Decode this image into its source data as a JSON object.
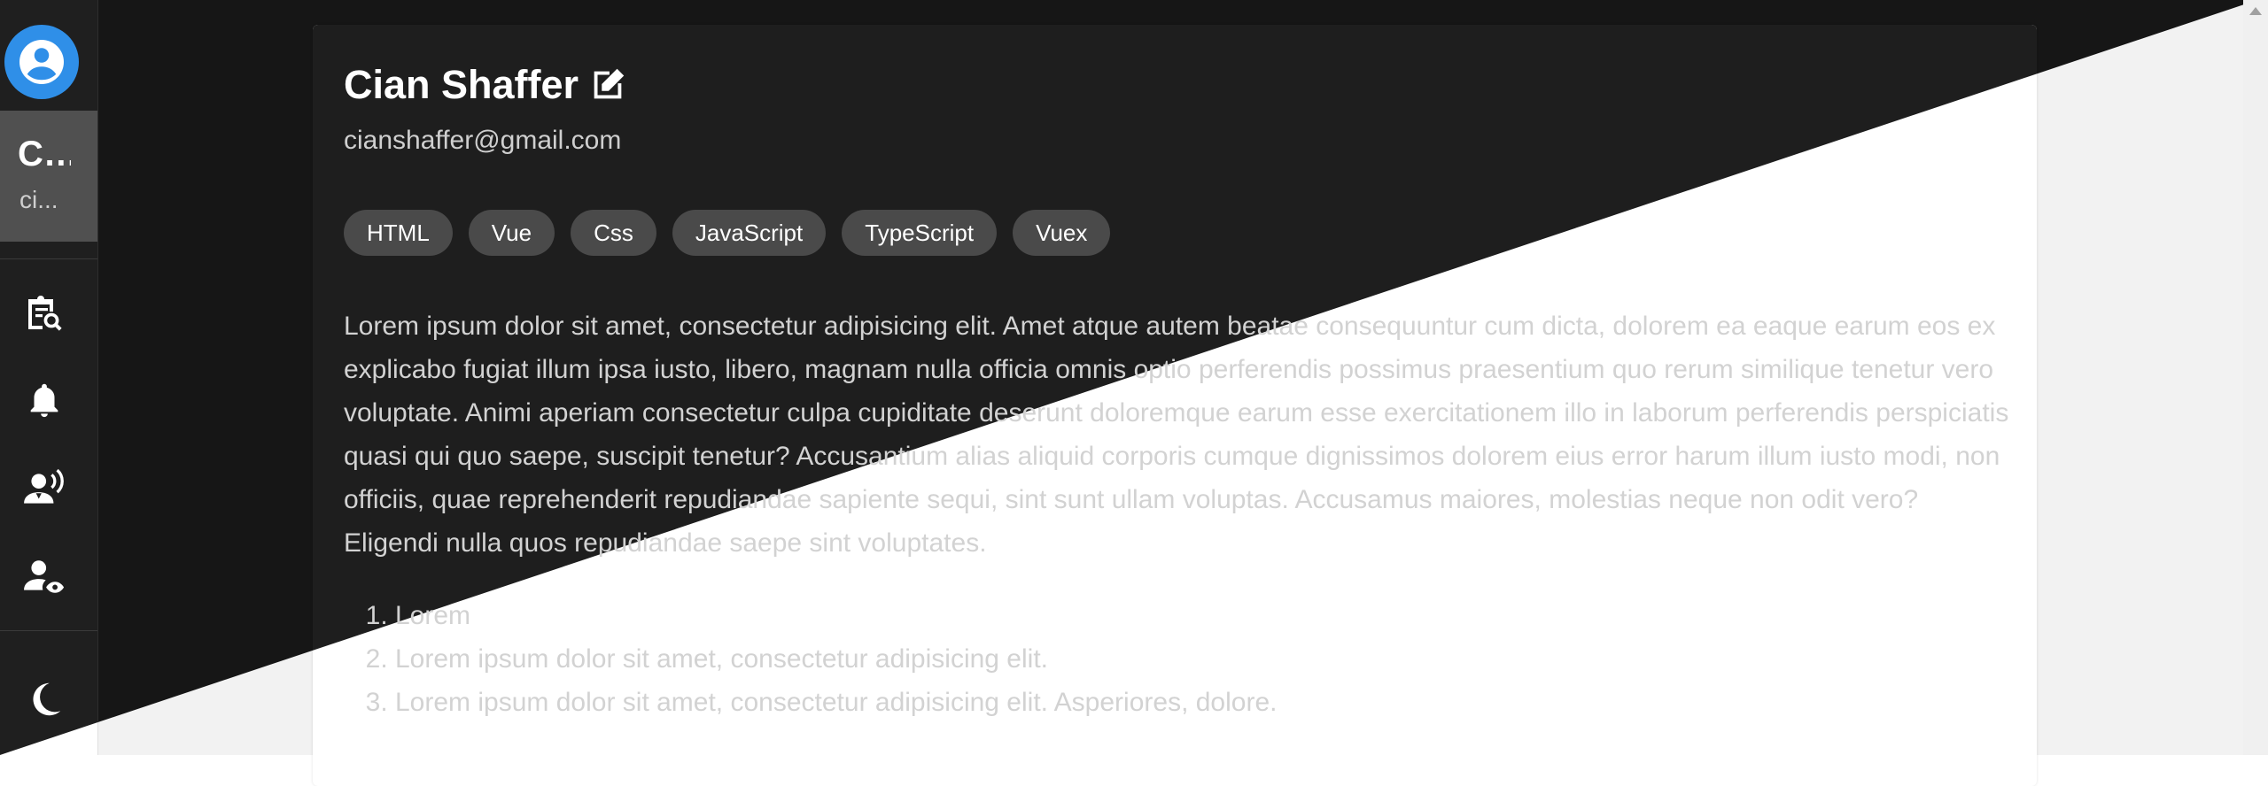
{
  "rail": {
    "user_name": "C...",
    "user_email": "ci...",
    "icons": [
      "account-circle-icon",
      "clipboard-search-icon",
      "bell-icon",
      "account-voice-icon",
      "account-eye-icon",
      "moon-icon"
    ]
  },
  "profile": {
    "name": "Cian Shaffer",
    "email": "cianshaffer@gmail.com",
    "tags": [
      "HTML",
      "Vue",
      "Css",
      "JavaScript",
      "TypeScript",
      "Vuex"
    ],
    "bio": "Lorem ipsum dolor sit amet, consectetur adipisicing elit. Amet atque autem beatae consequuntur cum dicta, dolorem ea eaque earum eos ex explicabo fugiat illum ipsa iusto, libero, magnam nulla officia omnis optio perferendis possimus praesentium quo rerum similique tenetur vero voluptate. Animi aperiam consectetur culpa cupiditate deserunt doloremque earum esse exercitationem illo in laborum perferendis perspiciatis quasi qui quo saepe, suscipit tenetur? Accusantium alias aliquid corporis cumque dignissimos dolorem eius error harum illum iusto modi, non officiis, quae reprehenderit repudiandae sapiente sequi, sint sunt ullam voluptas. Accusamus maiores, molestias neque non odit vero? Eligendi nulla quos repudiandae saepe sint voluptates.",
    "list": [
      "Lorem",
      "Lorem ipsum dolor sit amet, consectetur adipisicing elit.",
      "Lorem ipsum dolor sit amet, consectetur adipisicing elit. Asperiores, dolore."
    ]
  },
  "colors": {
    "dark_bg": "#161616",
    "card_dark": "#1e1e1e",
    "chip": "#4a4a4a",
    "avatar": "#2f8fe8"
  }
}
